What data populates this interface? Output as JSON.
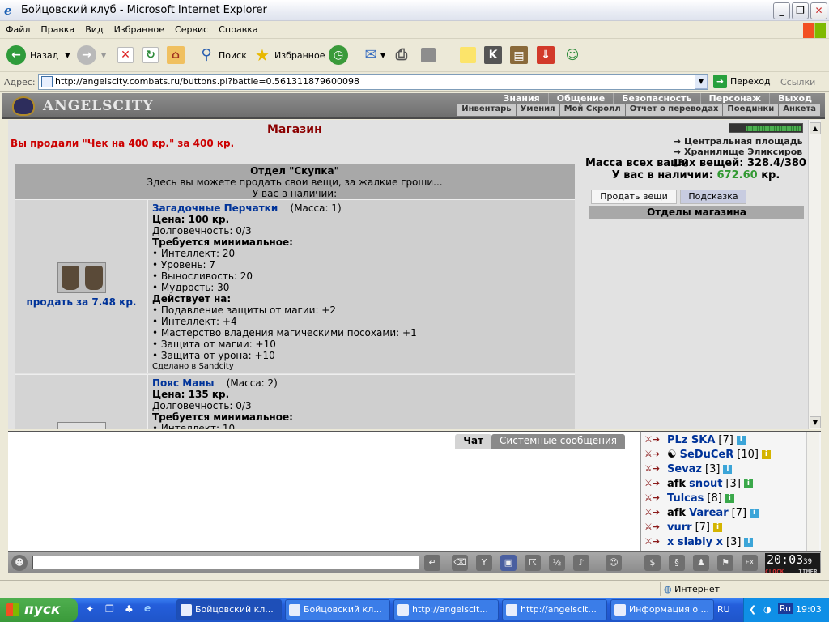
{
  "window": {
    "title": "Бойцовский клуб - Microsoft Internet Explorer"
  },
  "menu": [
    "Файл",
    "Правка",
    "Вид",
    "Избранное",
    "Сервис",
    "Справка"
  ],
  "toolbar": {
    "back": "Назад",
    "search": "Поиск",
    "favorites": "Избранное"
  },
  "address": {
    "label": "Адрес:",
    "url": "http://angelscity.combats.ru/buttons.pl?battle=0.561311879600098",
    "go": "Переход",
    "links": "Ссылки"
  },
  "game": {
    "logo": "ANGELSCITY",
    "topnav": [
      "Знания",
      "Общение",
      "Безопасность",
      "Персонаж",
      "Выход"
    ],
    "subnav": [
      "Инвентарь",
      "Умения",
      "Мой Скролл",
      "Отчет о переводах",
      "Поединки",
      "Анкета"
    ]
  },
  "shop": {
    "title": "Магазин",
    "sold_message": "Вы продали \"Чек на 400 кр.\" за 400 кр.",
    "dept_title": "Отдел \"Скупка\"",
    "dept_desc": "Здесь вы можете продать свои вещи, за жалкие гроши...",
    "dept_have": "У вас в наличии:",
    "items": [
      {
        "name": "Загадочные Перчатки",
        "mass": "(Масса: 1)",
        "price": "Цена: 100 кр.",
        "durability": "Долговечность: 0/3",
        "req_title": "Требуется минимальное:",
        "reqs": [
          "• Интеллект: 20",
          "• Уровень: 7",
          "• Выносливость: 20",
          "• Мудрость: 30"
        ],
        "effects_title": "Действует на:",
        "effects": [
          "• Подавление защиты от магии: +2",
          "• Интеллект: +4",
          "• Мастерство владения магическими посохами: +1",
          "• Защита от магии: +10",
          "• Защита от урона: +10"
        ],
        "made_in": "Сделано в Sandcity",
        "sell": "продать за 7.48 кр."
      },
      {
        "name": "Пояс Маны",
        "mass": "(Масса: 2)",
        "price": "Цена: 135 кр.",
        "durability": "Долговечность: 0/3",
        "req_title": "Требуется минимальное:",
        "reqs": [
          "• Интеллект: 10"
        ]
      }
    ],
    "side": {
      "links": [
        "Центральная площадь",
        "Хранилище Эликсиров [3]"
      ],
      "mass_label": "Масса всех ваших вещей: 328.4/380",
      "money_label": "У вас в наличии:",
      "money_value": "672.60",
      "money_unit": "кр.",
      "tab_sell": "Продать вещи",
      "tab_hint": "Подсказка",
      "departments": "Отделы магазина"
    }
  },
  "chat": {
    "tabs": [
      "Чат",
      "Системные сообщения"
    ],
    "users": [
      {
        "prefix": "",
        "name": "PLz SKA",
        "level": "[7]",
        "icon": "b"
      },
      {
        "prefix": "",
        "name": "SeDuCeR",
        "level": "[10]",
        "icon": "y"
      },
      {
        "prefix": "",
        "name": "Sevaz",
        "level": "[3]",
        "icon": "b"
      },
      {
        "prefix": "afk",
        "name": "snout",
        "level": "[3]",
        "icon": "g"
      },
      {
        "prefix": "",
        "name": "Tulcas",
        "level": "[8]",
        "icon": "g"
      },
      {
        "prefix": "afk",
        "name": "Varear",
        "level": "[7]",
        "icon": "b"
      },
      {
        "prefix": "",
        "name": "vurr",
        "level": "[7]",
        "icon": "y"
      },
      {
        "prefix": "",
        "name": "x slabiy x",
        "level": "[3]",
        "icon": "b"
      }
    ]
  },
  "clock": {
    "time": "20:03",
    "seconds": "39",
    "label_clock": "CLOCK",
    "label_timer": "TIMER"
  },
  "status": {
    "zone": "Интернет"
  },
  "taskbar": {
    "start": "пуск",
    "tasks": [
      "Бойцовский кл...",
      "Бойцовский кл...",
      "http://angelscit...",
      "http://angelscit...",
      "Информация о ..."
    ],
    "lang": "RU",
    "time": "19:03"
  }
}
